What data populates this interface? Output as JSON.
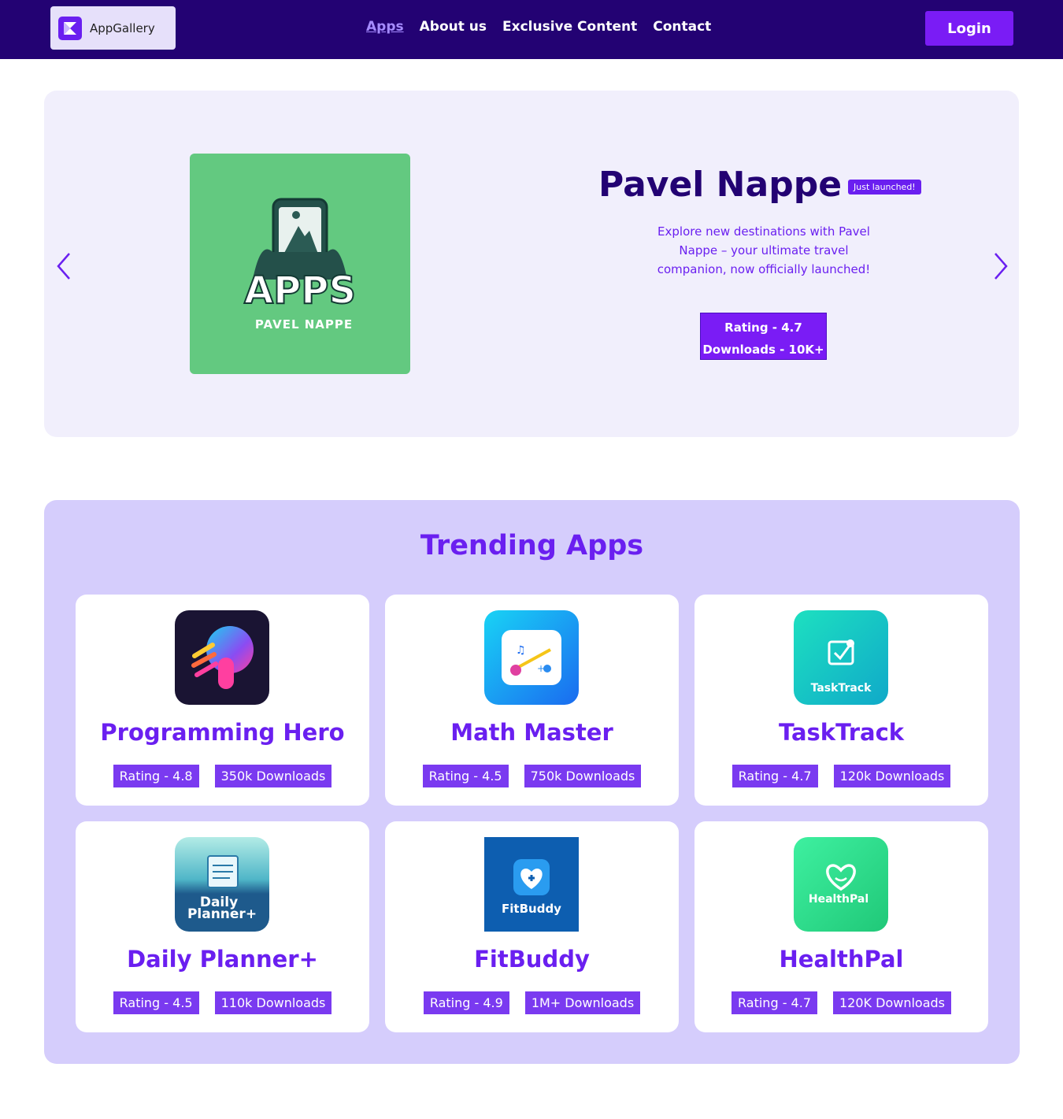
{
  "nav": {
    "logo_text": "AppGallery",
    "items": [
      {
        "label": "Apps",
        "active": true
      },
      {
        "label": "About us"
      },
      {
        "label": "Exclusive Content"
      },
      {
        "label": "Contact"
      }
    ],
    "login_label": "Login"
  },
  "hero": {
    "image_title": "APPS",
    "image_subtitle": "PAVEL NAPPE",
    "title": "Pavel Nappe",
    "badge": "Just launched!",
    "description": "Explore new destinations with Pavel Nappe – your ultimate travel companion, now officially launched!",
    "rating": "Rating - 4.7",
    "downloads": "Downloads - 10K+"
  },
  "trending": {
    "title": "Trending Apps",
    "apps": [
      {
        "name": "Programming Hero",
        "rating": "Rating - 4.8",
        "downloads": "350k Downloads",
        "icon": "programming-hero-icon"
      },
      {
        "name": "Math Master",
        "rating": "Rating - 4.5",
        "downloads": "750k Downloads",
        "icon": "math-master-icon"
      },
      {
        "name": "TaskTrack",
        "rating": "Rating - 4.7",
        "downloads": "120k Downloads",
        "icon": "tasktrack-icon",
        "icon_text": "TaskTrack"
      },
      {
        "name": "Daily Planner+",
        "rating": "Rating - 4.5",
        "downloads": "110k Downloads",
        "icon": "daily-planner-icon",
        "icon_text_1": "Daily",
        "icon_text_2": "Planner+"
      },
      {
        "name": "FitBuddy",
        "rating": "Rating - 4.9",
        "downloads": "1M+ Downloads",
        "icon": "fitbuddy-icon",
        "icon_text": "FitBuddy"
      },
      {
        "name": "HealthPal",
        "rating": "Rating - 4.7",
        "downloads": "120K Downloads",
        "icon": "healthpal-icon",
        "icon_text": "HealthPal"
      }
    ]
  },
  "colors": {
    "nav_bg": "#230273",
    "accent": "#7a1cf5",
    "hero_bg": "#f1effc",
    "trend_bg": "#d5cdfc"
  }
}
